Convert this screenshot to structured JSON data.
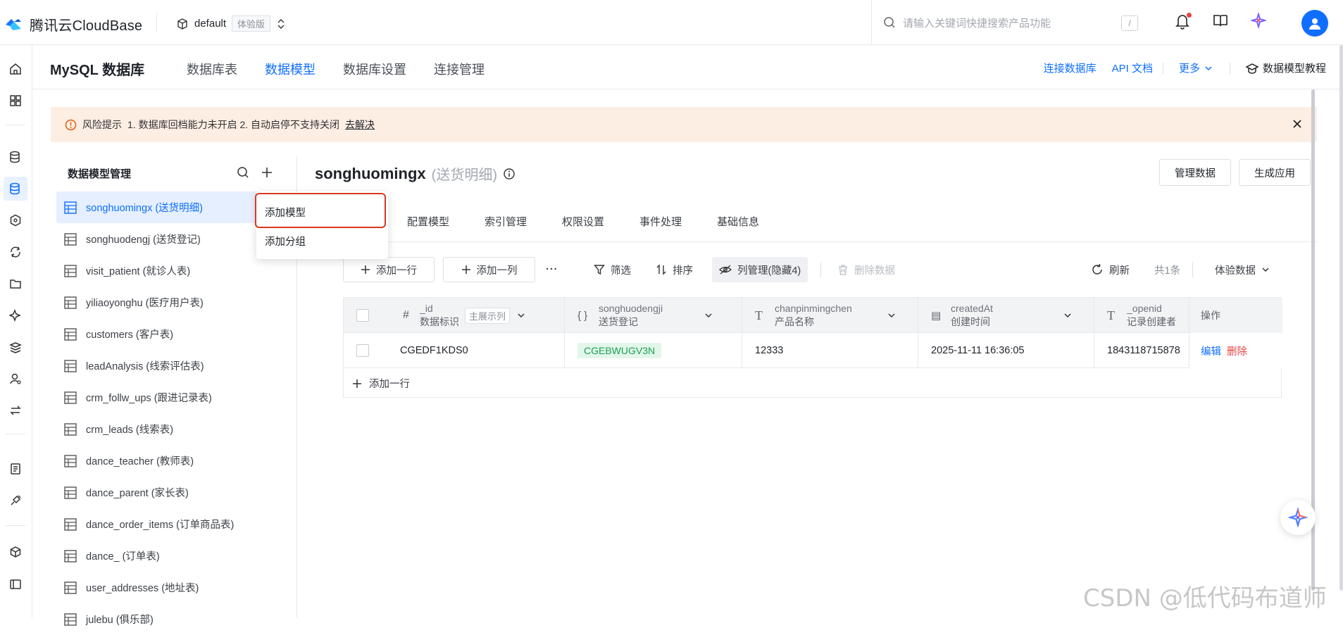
{
  "topbar": {
    "brand": "腾讯云CloudBase",
    "env_name": "default",
    "env_badge": "体验版",
    "search_placeholder": "请输入关键词快捷搜索产品功能",
    "search_shortcut": "/"
  },
  "subnav": {
    "db_title": "MySQL 数据库",
    "tabs": [
      "数据库表",
      "数据模型",
      "数据库设置",
      "连接管理"
    ],
    "active_tab": "数据模型",
    "links": {
      "connect": "连接数据库",
      "api_docs": "API 文档",
      "more": "更多",
      "tutorial": "数据模型教程"
    }
  },
  "alert": {
    "title": "风险提示",
    "text": "1. 数据库回档能力未开启  2. 自动启停不支持关闭",
    "action": "去解决"
  },
  "sidebar": {
    "title": "数据模型管理",
    "items": [
      "songhuomingx (送货明细)",
      "songhuodengj (送货登记)",
      "visit_patient (就诊人表)",
      "yiliaoyonghu (医疗用户表)",
      "customers (客户表)",
      "leadAnalysis (线索评估表)",
      "crm_follw_ups (跟进记录表)",
      "crm_leads (线索表)",
      "dance_teacher (教师表)",
      "dance_parent (家长表)",
      "dance_order_items (订单商品表)",
      "dance_ (订单表)",
      "user_addresses (地址表)",
      "julebu (俱乐部)"
    ]
  },
  "popup": {
    "add_model": "添加模型",
    "add_group": "添加分组"
  },
  "main": {
    "title_en": "songhuomingx",
    "title_cn": "(送货明细)",
    "manage_data": "管理数据",
    "generate_app": "生成应用",
    "tabs": [
      "配置模型",
      "索引管理",
      "权限设置",
      "事件处理",
      "基础信息"
    ],
    "toolbar": {
      "add_row": "添加一行",
      "add_col": "添加一列",
      "more": "···",
      "filter": "筛选",
      "sort": "排序",
      "columns": "列管理(隐藏4)",
      "delete": "删除数据",
      "refresh": "刷新",
      "total": "共1条",
      "env_data": "体验数据"
    },
    "table": {
      "columns": [
        {
          "icon": "#",
          "name": "_id",
          "label": "数据标识",
          "extra": "主展示列"
        },
        {
          "icon": "{ }",
          "name": "songhuodengji",
          "label": "送货登记"
        },
        {
          "icon": "T",
          "name": "chanpinmingchen",
          "label": "产品名称"
        },
        {
          "icon": "▤",
          "name": "createdAt",
          "label": "创建时间"
        },
        {
          "icon": "T",
          "name": "_openid",
          "label": "记录创建者"
        }
      ],
      "ops_header": "操作",
      "rows": [
        {
          "id": "CGEDF1KDS0",
          "songhuodengji": "CGEBWUGV3N",
          "chanpinmingchen": "12333",
          "createdAt": "2025-11-11 16:36:05",
          "openid": "1843118715878",
          "edit": "编辑",
          "delete": "删除"
        }
      ],
      "add_row": "添加一行"
    }
  },
  "watermark": "CSDN @低代码布道师"
}
